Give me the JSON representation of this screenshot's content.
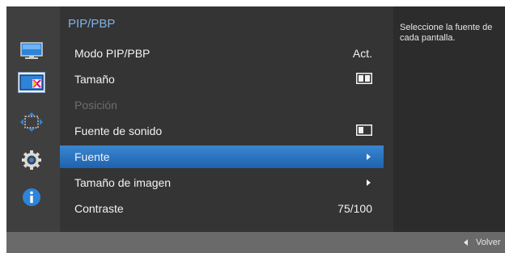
{
  "menu": {
    "title": "PIP/PBP",
    "items": [
      {
        "label": "Modo PIP/PBP",
        "value": "Act."
      },
      {
        "label": "Tamaño",
        "value_icon": "split-screen-icon"
      },
      {
        "label": "Posición",
        "disabled": true
      },
      {
        "label": "Fuente de sonido",
        "value_icon": "left-screen-icon"
      },
      {
        "label": "Fuente",
        "value_icon": "arrow-right-icon",
        "selected": true
      },
      {
        "label": "Tamaño de imagen",
        "value_icon": "arrow-right-icon"
      },
      {
        "label": "Contraste",
        "value": "75/100"
      }
    ]
  },
  "help": {
    "text": "Seleccione la fuente de cada pantalla."
  },
  "footer": {
    "back_label": "Volver"
  },
  "sidebar": {
    "icons": [
      "monitor-icon",
      "pip-icon",
      "position-arrows-icon",
      "gear-icon",
      "info-icon"
    ],
    "selected_index": 1
  },
  "colors": {
    "highlight": "#2b73c2",
    "title": "#7fb2e6"
  }
}
